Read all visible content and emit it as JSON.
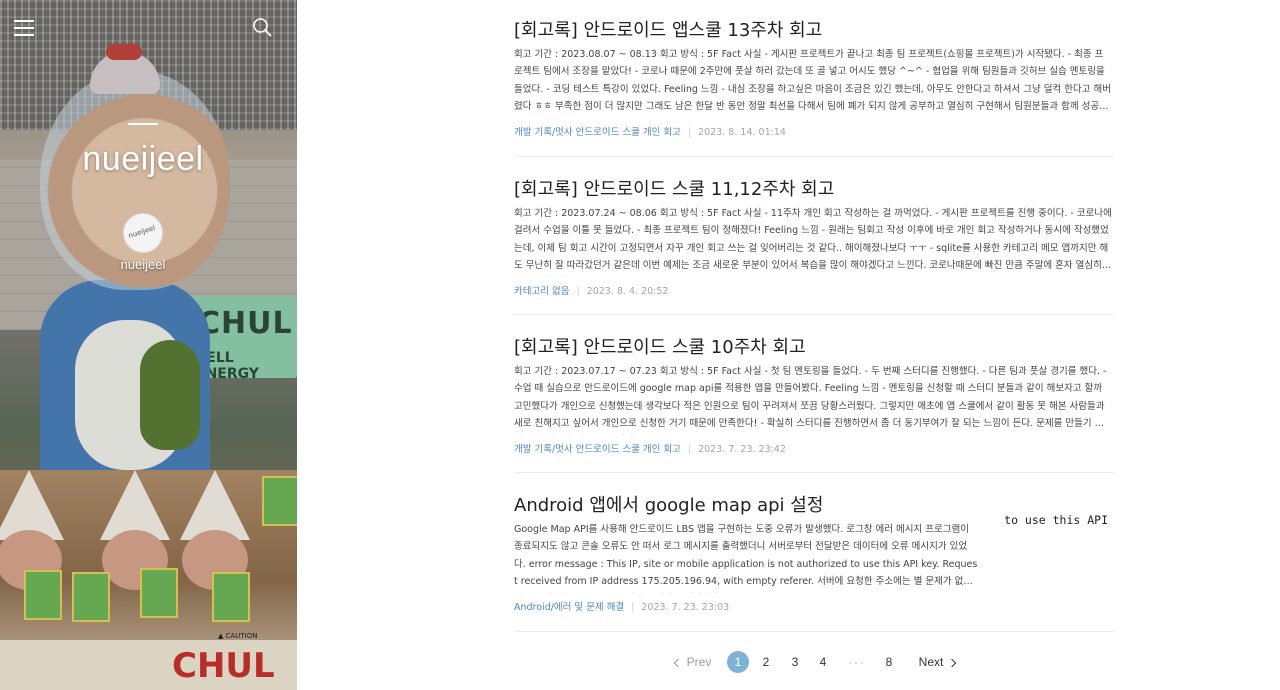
{
  "sidebar": {
    "blog_title": "nueijeel",
    "owner_name": "nueijeel",
    "avatar_scribble": "nueijeel",
    "scene_sign_text": "CHUL",
    "scene_sign_sub": "CELL ENERGY",
    "scene_banner_text": "CHUL",
    "scene_caution_text": "▲ CAUTION"
  },
  "posts": [
    {
      "title": "[회고록] 안드로이드 앱스쿨 13주차 회고",
      "summary": "회고 기간 : 2023.08.07 ~ 08.13 회고 방식 : 5F Fact 사실 - 게시판 프로젝트가 끝나고 최종 팀 프로젝트(쇼핑몰 프로젝트)가 시작됐다. - 최종 프로젝트 팀에서 조장을 맡았다! - 코로나 때문에 2주만에 풋살 하러 갔는데 또 골 넣고 어시도 했당 ^~^ - 협업을 위해 팀원들과 깃허브 실습 멘토링을 들었다. - 코딩 테스트 특강이 있었다. Feeling 느낌 - 내심 조장을 하고싶은 마음이 조금은 있긴 했는데, 아무도 안한다고 하셔서 그냥 덜컥 한다고 해버렸다 ㅎㅎ 부족한 점이 더 많지만 그래도 남은 한달 반 동안 정말 최선을 다해서 팀에 폐가 되지 않게 공부하고 열심히 구현해서 팀원분들과 함께 성공적인 결과를 만들어 내고 싶다.",
      "category": "개발 기록/멋사 안드로이드 스쿨 개인 회고",
      "date": "2023. 8. 14. 01:14"
    },
    {
      "title": "[회고록] 안드로이드 스쿨 11,12주차 회고",
      "summary": "회고 기간 : 2023.07.24 ~ 08.06 회고 방식 : 5F Fact 사실 - 11주차 개인 회고 작성하는 걸 까먹었다. - 게시판 프로젝트를 진행 중이다. - 코로나에 걸려서 수업을 이틀 못 들었다. - 최종 프로젝트 팀이 정해졌다! Feeling 느낌 - 원래는 팀회고 작성 이후에 바로 개인 회고 작성하거나 동시에 작성했었는데, 이제 팀 회고 시간이 고정되면서 자꾸 개인 회고 쓰는 걸 잊어버리는 것 같다.. 해이해졌나보다 ㅜㅜ - sqlite를 사용한 카테고리 메모 앱까지만 해도 무난히 잘 따라갔던거 같은데 이번 예제는 조금 새로운 부분이 있어서 복습을 많이 해야겠다고 느낀다. 코로나때문에 빠진 만큼 주말에 혼자 열심히 복습해야겠다.",
      "category": "카테고리 없음",
      "date": "2023. 8. 4. 20:52"
    },
    {
      "title": "[회고록] 안드로이드 스쿨 10주차 회고",
      "summary": "회고 기간 : 2023.07.17 ~ 07.23 회고 방식 : 5F Fact 사실 - 첫 팀 멘토링을 들었다. - 두 번째 스터디를 진행했다. - 다른 팀과 풋살 경기를 했다. - 수업 때 실습으로 안드로이드에 google map api를 적용한 앱을 만들어봤다. Feeling 느낌 - 멘토링을 신청할 때 스터디 분들과 같이 해보자고 할까 고민했다가 개인으로 신청했는데 생각보다 적은 인원으로 팀이 꾸려져서 쪼끔 당황스러웠다. 그렇지만 애초에 앱 스쿨에서 같이 활동 못 해본 사람들과 새로 친해지고 싶어서 개인으로 신청한 거기 때문에 만족한다! - 확실히 스터디를 진행하면서 좀 더 동기부여가 잘 되는 느낌이 든다. 문제를 만들기 위해 수업 내용을 다시 보게 된다.",
      "category": "개발 기록/멋사 안드로이드 스쿨 개인 회고",
      "date": "2023. 7. 23. 23:42"
    },
    {
      "title": "Android 앱에서 google map api 설정",
      "summary": "Google Map API를 사용해 안드로이드 LBS 앱을 구현하는 도중 오류가 발생했다. 로그창 에러 메시지 프로그램이 종료되지도 않고 콘솔 오류도 안 떠서 로그 메시지를 출력했더니 서버로부터 전달받은 데이터에 오류 메시지가 있었다. error message : This IP, site or mobile application is not authorized to use this API key. Request received from IP address 175.205.196.94, with empty referer. 서버에 요청한 주소에는 별 문제가 없었기 때문에 이 오류는 API 키 설정 문제라고 판단했다.",
      "category": "Android/에러 및 문제 해결",
      "date": "2023. 7. 23. 23:03",
      "thumbnail_text": "d to use this API"
    }
  ],
  "pagination": {
    "prev_label": "Prev",
    "pages": [
      "1",
      "2",
      "3",
      "4",
      "8"
    ],
    "ellipsis": "···",
    "active_page": "1",
    "next_label": "Next"
  },
  "colors": {
    "accent": "#7fb3d5",
    "category_link": "#4a89c4",
    "date_text": "#a5a5a5",
    "title_text": "#222222"
  },
  "icons": {
    "menu": "hamburger-icon",
    "search": "search-icon",
    "prev": "chevron-left-icon",
    "next": "chevron-right-icon"
  }
}
